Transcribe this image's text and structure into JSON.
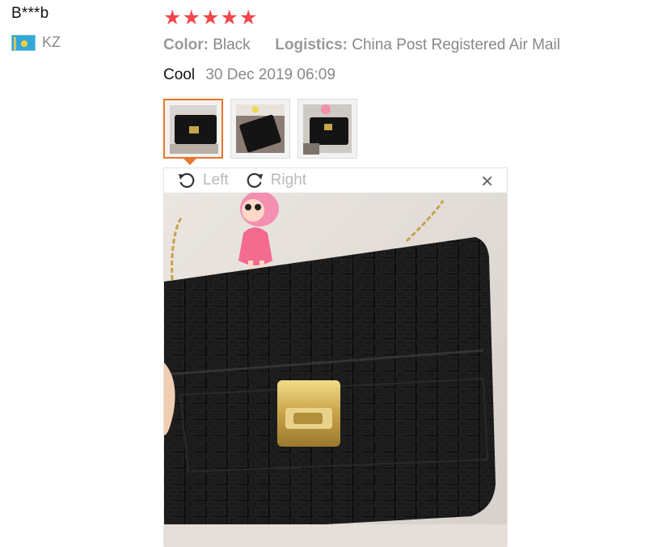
{
  "reviewer": {
    "name": "B***b",
    "country_code": "KZ",
    "flag_icon": "kazakhstan-flag-icon"
  },
  "rating": {
    "stars": 5,
    "max": 5,
    "color": "#f5464b"
  },
  "attributes": {
    "color_label": "Color:",
    "color_value": "Black",
    "logistics_label": "Logistics:",
    "logistics_value": "China Post Registered Air Mail"
  },
  "review": {
    "text": "Cool",
    "date": "30 Dec 2019 06:09"
  },
  "thumbnails": {
    "count": 3,
    "active_index": 0,
    "active_border_color": "#e8762d"
  },
  "viewer": {
    "rotate_left_label": "Left",
    "rotate_right_label": "Right",
    "close_icon": "close-icon"
  }
}
